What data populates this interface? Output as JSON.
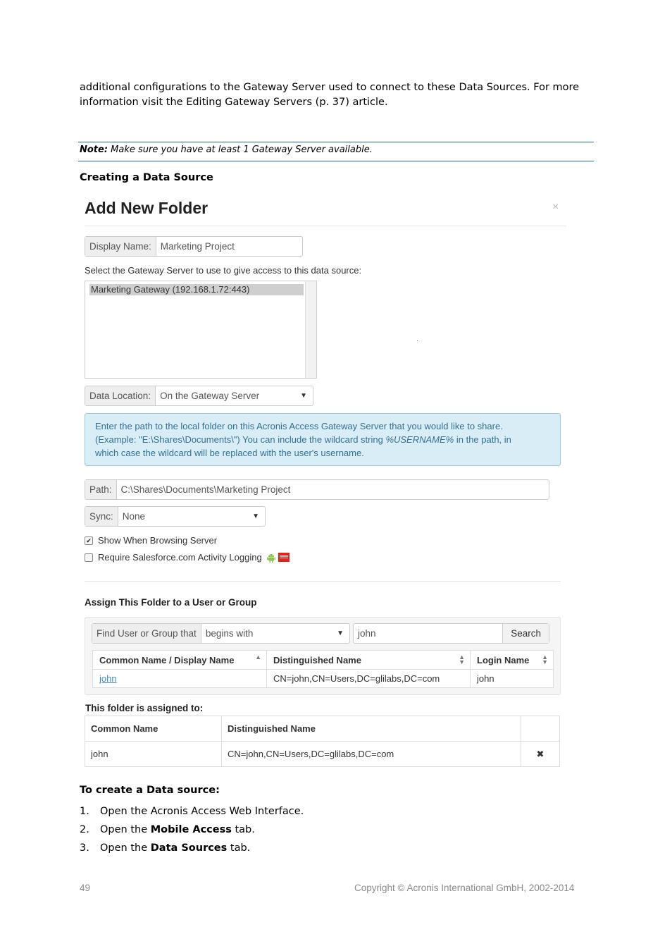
{
  "intro": {
    "line1": "additional configurations to the Gateway Server used to connect to these Data Sources. For more",
    "line2": "information visit the Editing Gateway Servers (p. 37) article."
  },
  "note": {
    "label": "Note:",
    "text": " Make sure you have at least 1 Gateway Server available."
  },
  "section_heading": "Creating a Data Source",
  "modal": {
    "title": "Add New Folder",
    "close": "×",
    "display_name_label": "Display Name:",
    "display_name_value": "Marketing Project",
    "gateway_prompt": "Select the Gateway Server to use to give access to this data source:",
    "gateway_options": [
      "Marketing Gateway (192.168.1.72:443)"
    ],
    "data_location_label": "Data Location:",
    "data_location_value": "On the Gateway Server",
    "info_text_1": "Enter the path to the local folder on this Acronis Access Gateway Server that you would like to share.",
    "info_text_2a": "(Example: \"E:\\Shares\\Documents\\\") You can include the wildcard string ",
    "info_wildcard": "%USERNAME%",
    "info_text_2b": " in the path, in",
    "info_text_3": "which case the wildcard will be replaced with the user's username.",
    "path_label": "Path:",
    "path_value": "C:\\Shares\\Documents\\Marketing Project",
    "sync_label": "Sync:",
    "sync_value": "None",
    "show_browsing_label": "Show When Browsing Server",
    "show_browsing_checked": true,
    "require_sf_label": "Require Salesforce.com Activity Logging",
    "require_sf_checked": false,
    "assign_heading": "Assign This Folder to a User or Group",
    "find_label": "Find User or Group that",
    "find_mode": "begins with",
    "find_query": "john",
    "search_button": "Search",
    "results_columns": [
      "Common Name / Display Name",
      "Distinguished Name",
      "Login Name"
    ],
    "results_rows": [
      {
        "common": "john",
        "dn": "CN=john,CN=Users,DC=glilabs,DC=com",
        "login": "john"
      }
    ],
    "assigned_heading": "This folder is assigned to:",
    "assigned_columns": [
      "Common Name",
      "Distinguished Name"
    ],
    "assigned_rows": [
      {
        "common": "john",
        "dn": "CN=john,CN=Users,DC=glilabs,DC=com",
        "remove": "✖"
      }
    ]
  },
  "todo_heading": "To create a Data source:",
  "steps": [
    {
      "n": "1.",
      "pre": "Open the Acronis Access Web Interface.",
      "bold": "",
      "post": ""
    },
    {
      "n": "2.",
      "pre": "Open the ",
      "bold": "Mobile Access",
      "post": " tab."
    },
    {
      "n": "3.",
      "pre": "Open the ",
      "bold": "Data Sources",
      "post": " tab."
    }
  ],
  "footer": {
    "page": "49",
    "copyright": "Copyright © Acronis International GmbH, 2002-2014"
  }
}
